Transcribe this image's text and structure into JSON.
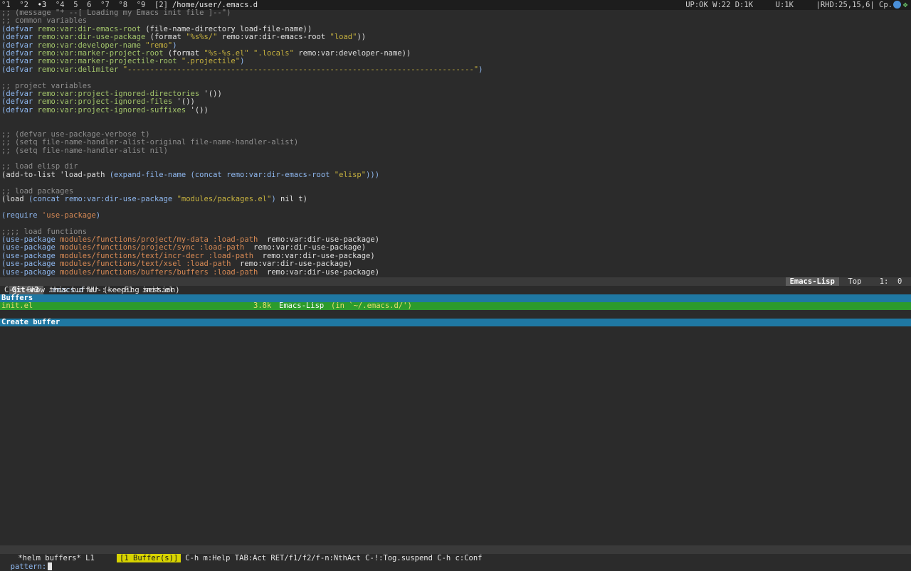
{
  "topbar": {
    "workspaces": [
      "°1",
      "°2",
      "•3",
      "°4",
      "5",
      "6",
      "°7",
      "°8",
      "°9"
    ],
    "current_index": 2,
    "window_count": "[2]",
    "path": "/home/user/.emacs.d",
    "status": "UP:OK W:22 D:1K     U:1K     |RHD:25,15,6| Cp."
  },
  "editor": {
    "lines": [
      [
        {
          "c": "cm",
          "t": ";; (message \"* --[ Loading my Emacs init file ]--\")"
        }
      ],
      [
        {
          "c": "cm",
          "t": ";; common variables"
        }
      ],
      [
        {
          "c": "kw",
          "t": "(defvar "
        },
        {
          "c": "vn",
          "t": "remo:var:dir-emacs-root "
        },
        {
          "c": "pl",
          "t": "(file-name-directory load-file-name))"
        }
      ],
      [
        {
          "c": "kw",
          "t": "(defvar "
        },
        {
          "c": "vn",
          "t": "remo:var:dir-use-package "
        },
        {
          "c": "pl",
          "t": "(format "
        },
        {
          "c": "st",
          "t": "\"%s%s/\""
        },
        {
          "c": "pl",
          "t": " remo:var:dir-emacs-root "
        },
        {
          "c": "st",
          "t": "\"load\""
        },
        {
          "c": "pl",
          "t": "))"
        }
      ],
      [
        {
          "c": "kw",
          "t": "(defvar "
        },
        {
          "c": "vn",
          "t": "remo:var:developer-name "
        },
        {
          "c": "st",
          "t": "\"remo\""
        },
        {
          "c": "kw",
          "t": ")"
        }
      ],
      [
        {
          "c": "kw",
          "t": "(defvar "
        },
        {
          "c": "vn",
          "t": "remo:var:marker-project-root "
        },
        {
          "c": "pl",
          "t": "(format "
        },
        {
          "c": "st",
          "t": "\"%s-%s.el\" \".locals\""
        },
        {
          "c": "pl",
          "t": " remo:var:developer-name))"
        }
      ],
      [
        {
          "c": "kw",
          "t": "(defvar "
        },
        {
          "c": "vn",
          "t": "remo:var:marker-projectile-root "
        },
        {
          "c": "st",
          "t": "\".projectile\""
        },
        {
          "c": "kw",
          "t": ")"
        }
      ],
      [
        {
          "c": "kw",
          "t": "(defvar "
        },
        {
          "c": "vn",
          "t": "remo:var:delimiter "
        },
        {
          "c": "st",
          "t": "\"-----------------------------------------------------------------------------\""
        },
        {
          "c": "kw",
          "t": ")"
        }
      ],
      [],
      [
        {
          "c": "cm",
          "t": ";; project variables"
        }
      ],
      [
        {
          "c": "kw",
          "t": "(defvar "
        },
        {
          "c": "vn",
          "t": "remo:var:project-ignored-directories "
        },
        {
          "c": "pl",
          "t": "'())"
        }
      ],
      [
        {
          "c": "kw",
          "t": "(defvar "
        },
        {
          "c": "vn",
          "t": "remo:var:project-ignored-files "
        },
        {
          "c": "pl",
          "t": "'())"
        }
      ],
      [
        {
          "c": "kw",
          "t": "(defvar "
        },
        {
          "c": "vn",
          "t": "remo:var:project-ignored-suffixes "
        },
        {
          "c": "pl",
          "t": "'())"
        }
      ],
      [],
      [],
      [
        {
          "c": "cm",
          "t": ";; (defvar use-package-verbose t)"
        }
      ],
      [
        {
          "c": "cm",
          "t": ";; (setq file-name-handler-alist-original file-name-handler-alist)"
        }
      ],
      [
        {
          "c": "cm",
          "t": ";; (setq file-name-handler-alist nil)"
        }
      ],
      [],
      [
        {
          "c": "cm",
          "t": ";; load elisp dir"
        }
      ],
      [
        {
          "c": "pl",
          "t": "(add-to-list 'load-path "
        },
        {
          "c": "kw",
          "t": "(expand-file-name (concat remo:var:dir-emacs-root "
        },
        {
          "c": "st",
          "t": "\"elisp\""
        },
        {
          "c": "kw",
          "t": ")))"
        }
      ],
      [],
      [
        {
          "c": "cm",
          "t": ";; load packages"
        }
      ],
      [
        {
          "c": "pl",
          "t": "(load "
        },
        {
          "c": "kw",
          "t": "(concat remo:var:dir-use-package "
        },
        {
          "c": "st",
          "t": "\"modules/packages.el\""
        },
        {
          "c": "kw",
          "t": ")"
        },
        {
          "c": "pl",
          "t": " nil t)"
        }
      ],
      [],
      [
        {
          "c": "kw",
          "t": "(require "
        },
        {
          "c": "ty",
          "t": "'use-package"
        },
        {
          "c": "kw",
          "t": ")"
        }
      ],
      [],
      [
        {
          "c": "cm",
          "t": ";;;; load functions"
        }
      ],
      [
        {
          "c": "kw",
          "t": "(use-package "
        },
        {
          "c": "ty",
          "t": "modules/functions/project/my-data :load-path "
        },
        {
          "c": "pl",
          "t": " remo:var:dir-use-package)"
        }
      ],
      [
        {
          "c": "kw",
          "t": "(use-package "
        },
        {
          "c": "ty",
          "t": "modules/functions/project/sync :load-path "
        },
        {
          "c": "pl",
          "t": " remo:var:dir-use-package)"
        }
      ],
      [
        {
          "c": "kw",
          "t": "(use-package "
        },
        {
          "c": "ty",
          "t": "modules/functions/text/incr-decr :load-path "
        },
        {
          "c": "pl",
          "t": " remo:var:dir-use-package)"
        }
      ],
      [
        {
          "c": "kw",
          "t": "(use-package "
        },
        {
          "c": "ty",
          "t": "modules/functions/text/xsel :load-path "
        },
        {
          "c": "pl",
          "t": " remo:var:dir-use-package)"
        }
      ],
      [
        {
          "c": "kw",
          "t": "(use-package "
        },
        {
          "c": "ty",
          "t": "modules/functions/buffers/buffers :load-path "
        },
        {
          "c": "pl",
          "t": " remo:var:dir-use-package)"
        }
      ]
    ]
  },
  "modeline": {
    "branch": "Git-v3",
    "dir": ".emacs.d",
    "state": "UU-:----F1",
    "buffer": "init.el",
    "mode": "Emacs-Lisp",
    "position": "Top",
    "line_col": "1:  0"
  },
  "echo": "C-j: Show this buffer (keeping session)",
  "helm": {
    "header": "Buffers",
    "row": {
      "name": "init.el",
      "size": "3.8k",
      "mode": "Emacs-Lisp",
      "location": "(in `~/.emacs.d/')"
    },
    "create_label": "Create buffer"
  },
  "helmline": {
    "name": "*helm buffers* L1",
    "count": "[1 Buffer(s)]",
    "help": "C-h m:Help TAB:Act RET/f1/f2/f-n:NthAct C-!:Tog.suspend C-h c:Conf"
  },
  "minibuffer": {
    "prompt": "pattern:"
  },
  "colors": {
    "helm_header": "#1f78a3",
    "helm_selection": "#2c9b2c",
    "badge": "#d7d300"
  }
}
